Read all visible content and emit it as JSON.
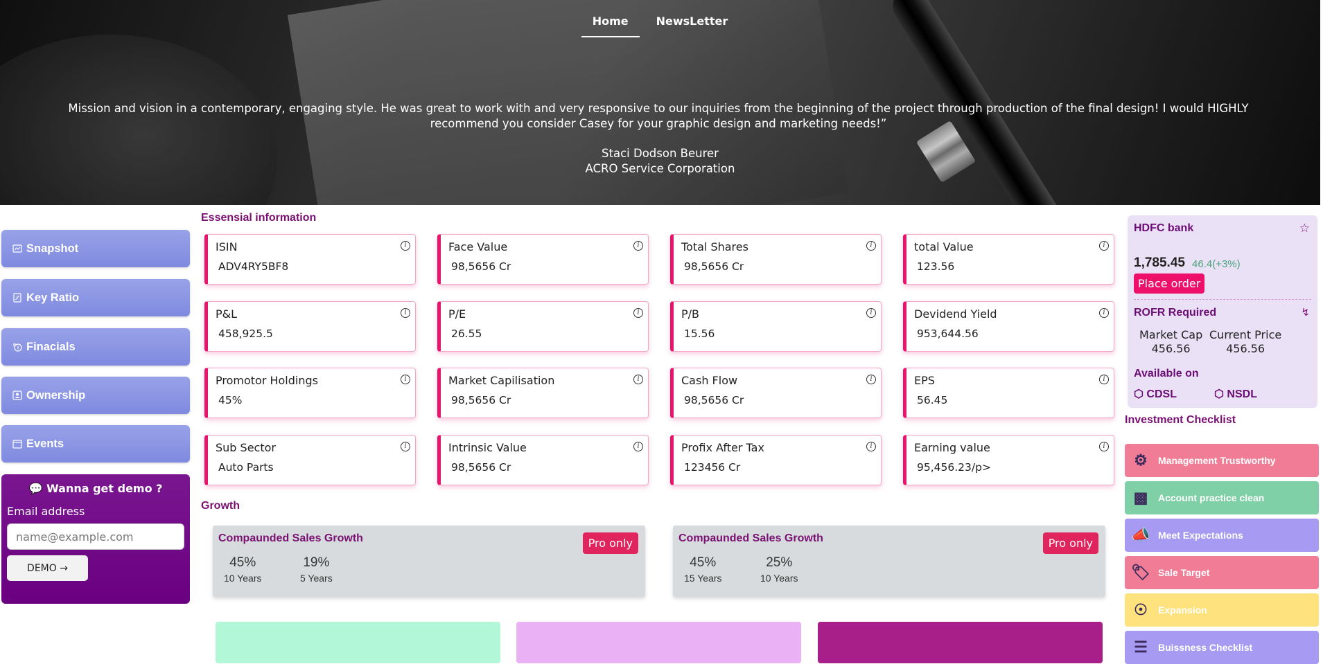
{
  "nav": {
    "home": "Home",
    "newsletter": "NewsLetter"
  },
  "hero": {
    "quote": "Mission and vision in a contemporary, engaging style. He was great to work with and very responsive to our inquiries from the beginning of the project through production of the final design! I would HIGHLY recommend you consider Casey for your graphic design and marketing needs!”",
    "author_name": "Staci Dodson Beurer",
    "author_company": "ACRO Service Corporation"
  },
  "sidebar": {
    "items": [
      {
        "label": "Snapshot",
        "icon": "snapshot-icon"
      },
      {
        "label": "Key Ratio",
        "icon": "key-ratio-icon"
      },
      {
        "label": "Finacials",
        "icon": "financials-icon"
      },
      {
        "label": "Ownership",
        "icon": "ownership-icon"
      },
      {
        "label": "Events",
        "icon": "events-icon"
      }
    ],
    "demo": {
      "title": "Wanna get demo ?",
      "email_label": "Email address",
      "email_placeholder": "name@example.com",
      "button": "DEMO →"
    }
  },
  "essential": {
    "title": "Essensial information",
    "cards": [
      {
        "title": "ISIN",
        "value": "ADV4RY5BF8"
      },
      {
        "title": "Face Value",
        "value": "98,5656 Cr"
      },
      {
        "title": "Total Shares",
        "value": "98,5656 Cr"
      },
      {
        "title": "total Value",
        "value": "123.56"
      },
      {
        "title": "P&L",
        "value": "458,925.5"
      },
      {
        "title": "P/E",
        "value": "26.55"
      },
      {
        "title": "P/B",
        "value": "15.56"
      },
      {
        "title": "Devidend Yield",
        "value": "953,644.56"
      },
      {
        "title": "Promotor Holdings",
        "value": "45%"
      },
      {
        "title": "Market Capilisation",
        "value": "98,5656 Cr"
      },
      {
        "title": "Cash Flow",
        "value": "98,5656 Cr"
      },
      {
        "title": "EPS",
        "value": "56.45"
      },
      {
        "title": "Sub Sector",
        "value": "Auto Parts"
      },
      {
        "title": "Intrinsic Value",
        "value": "98,5656 Cr"
      },
      {
        "title": "Profix After Tax",
        "value": "123456 Cr"
      },
      {
        "title": "Earning value",
        "value": "95,456.23/p>"
      }
    ]
  },
  "growth": {
    "title": "Growth",
    "panels": [
      {
        "title": "Compaunded Sales Growth",
        "badge": "Pro only",
        "stats": [
          {
            "value": "45%",
            "label": "10 Years"
          },
          {
            "value": "19%",
            "label": "5 Years"
          }
        ]
      },
      {
        "title": "Compaunded Sales Growth",
        "badge": "Pro only",
        "stats": [
          {
            "value": "45%",
            "label": "15 Years"
          },
          {
            "value": "25%",
            "label": "10 Years"
          }
        ]
      }
    ]
  },
  "stock": {
    "name": "HDFC bank",
    "price": "1,785.45",
    "change": "46.4(+3%)",
    "order_button": "Place order",
    "rofr": "ROFR Required",
    "market_cap_label": "Market Cap",
    "market_cap_value": "456.56",
    "current_price_label": "Current Price",
    "current_price_value": "456.56",
    "available_label": "Available on",
    "exchanges": [
      "CDSL",
      "NSDL"
    ]
  },
  "checklist": {
    "title": "Investment Checklist",
    "items": [
      {
        "label": "Management Trustworthy",
        "color": "#f07c96"
      },
      {
        "label": "Account practice clean",
        "color": "#7fd0a6"
      },
      {
        "label": "Meet Expectations",
        "color": "#a79af2"
      },
      {
        "label": "Sale Target",
        "color": "#f07c96"
      },
      {
        "label": "Expansion",
        "color": "#fde27e"
      },
      {
        "label": "Buissness Checklist",
        "color": "#a79af2"
      }
    ]
  },
  "colors": {
    "accent": "#e8136c",
    "brand": "#7a1072",
    "tile1": "#b2f8d8",
    "tile2": "#eab1f5",
    "tile3": "#a81f8a"
  }
}
